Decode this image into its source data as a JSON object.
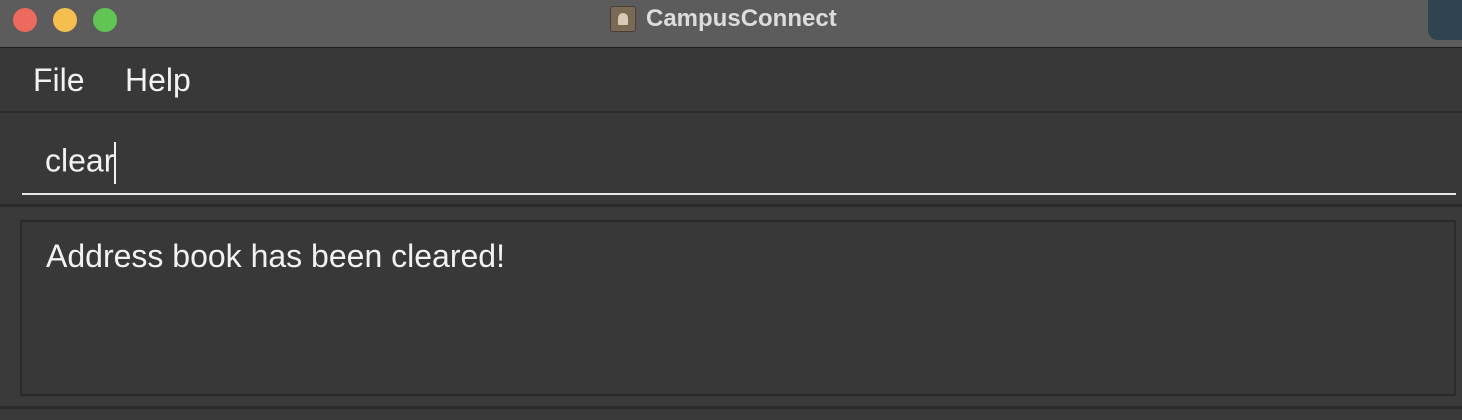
{
  "window": {
    "title": "CampusConnect",
    "app_icon": "address-book-icon"
  },
  "menubar": {
    "items": [
      {
        "label": "File"
      },
      {
        "label": "Help"
      }
    ]
  },
  "command_box": {
    "value": "clear"
  },
  "result_display": {
    "message": "Address book has been cleared!"
  },
  "colors": {
    "close": "#ed6a5e",
    "minimize": "#f5bf4f",
    "zoom": "#61c554",
    "background": "#383838",
    "text": "#f2f2f2"
  }
}
